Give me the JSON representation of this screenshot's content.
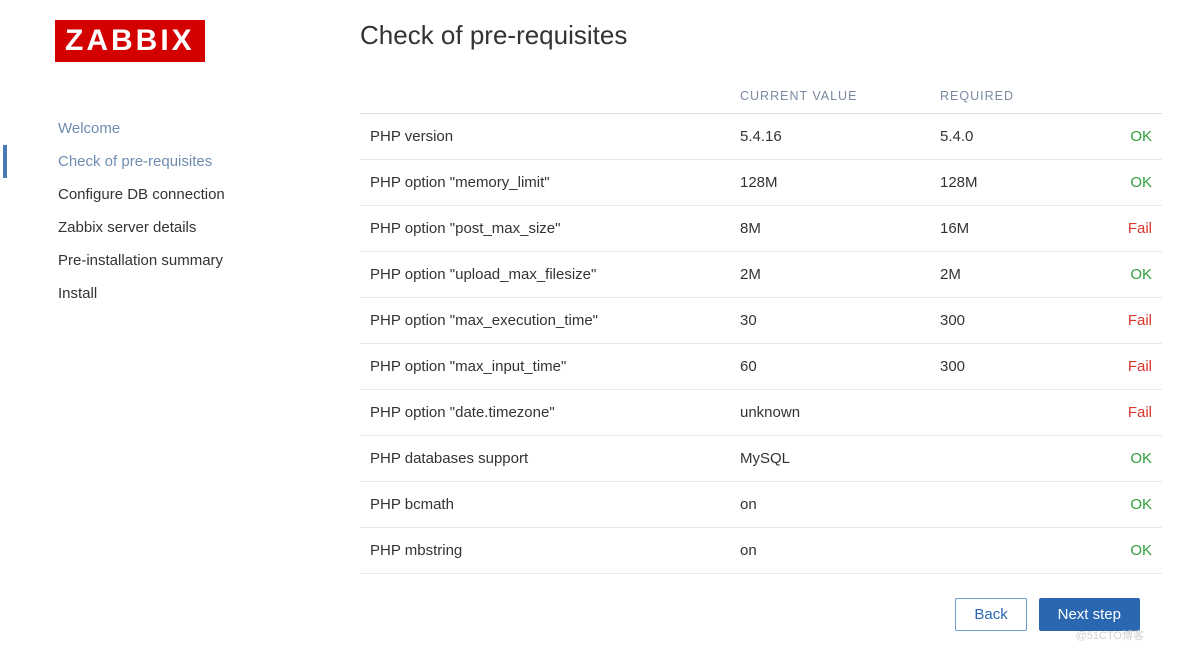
{
  "logo": "ZABBIX",
  "nav": {
    "items": [
      {
        "label": "Welcome",
        "state": "visited"
      },
      {
        "label": "Check of pre-requisites",
        "state": "active"
      },
      {
        "label": "Configure DB connection",
        "state": ""
      },
      {
        "label": "Zabbix server details",
        "state": ""
      },
      {
        "label": "Pre-installation summary",
        "state": ""
      },
      {
        "label": "Install",
        "state": ""
      }
    ]
  },
  "main": {
    "title": "Check of pre-requisites",
    "headers": {
      "name": "",
      "current": "CURRENT VALUE",
      "required": "REQUIRED",
      "status": ""
    },
    "rows": [
      {
        "name": "PHP version",
        "current": "5.4.16",
        "required": "5.4.0",
        "status": "OK",
        "ok": true
      },
      {
        "name": "PHP option \"memory_limit\"",
        "current": "128M",
        "required": "128M",
        "status": "OK",
        "ok": true
      },
      {
        "name": "PHP option \"post_max_size\"",
        "current": "8M",
        "required": "16M",
        "status": "Fail",
        "ok": false
      },
      {
        "name": "PHP option \"upload_max_filesize\"",
        "current": "2M",
        "required": "2M",
        "status": "OK",
        "ok": true
      },
      {
        "name": "PHP option \"max_execution_time\"",
        "current": "30",
        "required": "300",
        "status": "Fail",
        "ok": false
      },
      {
        "name": "PHP option \"max_input_time\"",
        "current": "60",
        "required": "300",
        "status": "Fail",
        "ok": false
      },
      {
        "name": "PHP option \"date.timezone\"",
        "current": "unknown",
        "required": "",
        "status": "Fail",
        "ok": false
      },
      {
        "name": "PHP databases support",
        "current": "MySQL",
        "required": "",
        "status": "OK",
        "ok": true
      },
      {
        "name": "PHP bcmath",
        "current": "on",
        "required": "",
        "status": "OK",
        "ok": true
      },
      {
        "name": "PHP mbstring",
        "current": "on",
        "required": "",
        "status": "OK",
        "ok": true
      }
    ]
  },
  "footer": {
    "back": "Back",
    "next": "Next step"
  },
  "watermark": "@51CTO博客"
}
